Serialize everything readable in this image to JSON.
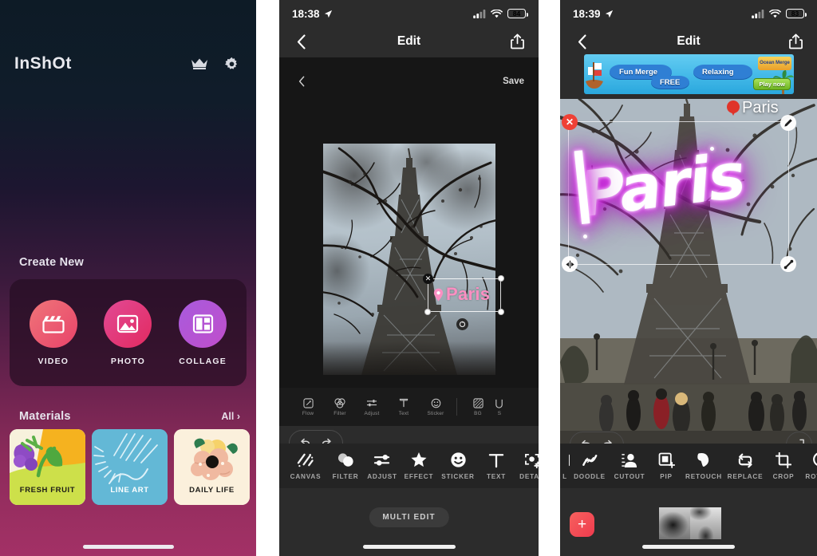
{
  "panel_home": {
    "brand": "InShOt",
    "icons": {
      "crown": "crown-icon",
      "settings": "gear-icon"
    },
    "create_new_title": "Create New",
    "create_items": [
      {
        "label": "VIDEO",
        "icon": "video-clapperboard-icon"
      },
      {
        "label": "PHOTO",
        "icon": "photo-image-icon"
      },
      {
        "label": "COLLAGE",
        "icon": "collage-grid-icon"
      }
    ],
    "materials_title": "Materials",
    "materials_all": "All ›",
    "materials": [
      {
        "label": "FRESH FRUIT",
        "theme": "fruit"
      },
      {
        "label": "LINE ART",
        "theme": "lineart"
      },
      {
        "label": "DAILY LIFE",
        "theme": "dailylife"
      }
    ]
  },
  "panel_edit": {
    "status": {
      "time": "18:38",
      "battery": "84",
      "location_icon": "location-arrow-icon",
      "signal_icon": "cellular-signal-icon",
      "wifi_icon": "wifi-icon"
    },
    "nav": {
      "back": "chevron-left-icon",
      "title": "Edit",
      "share": "share-upload-icon"
    },
    "inner": {
      "back": "chevron-left-icon",
      "save_label": "Save"
    },
    "sticker": {
      "text": "Paris",
      "pin_icon": "location-pin-icon",
      "color": "#fb8fc2"
    },
    "inner_tools": [
      {
        "label": "Flow",
        "icon": "flow-icon"
      },
      {
        "label": "Filter",
        "icon": "filter-circles-icon"
      },
      {
        "label": "Adjust",
        "icon": "adjust-sliders-icon"
      },
      {
        "label": "Text",
        "icon": "text-t-icon"
      },
      {
        "label": "Sticker",
        "icon": "sticker-smiley-icon"
      },
      {
        "label": "BG",
        "icon": "background-icon"
      },
      {
        "label": "S",
        "icon": "partial-icon"
      }
    ],
    "undo_redo": {
      "undo": "undo-arrow-icon",
      "redo": "redo-arrow-icon"
    },
    "expand": "expand-collapse-icon",
    "main_tools": [
      {
        "label": "CANVAS",
        "icon": "canvas-stripes-icon"
      },
      {
        "label": "FILTER",
        "icon": "filter-drops-icon"
      },
      {
        "label": "ADJUST",
        "icon": "adjust-sliders-icon"
      },
      {
        "label": "EFFECT",
        "icon": "effect-star-icon"
      },
      {
        "label": "STICKER",
        "icon": "sticker-smiley-icon"
      },
      {
        "label": "TEXT",
        "icon": "text-t-icon"
      },
      {
        "label": "DETAIL",
        "icon": "detail-focus-icon"
      },
      {
        "label": "D",
        "icon": "doodle-icon-partial"
      }
    ],
    "multi_edit_label": "MULTI EDIT"
  },
  "panel_doodle": {
    "status": {
      "time": "18:39",
      "battery": "83",
      "location_icon": "location-arrow-icon",
      "signal_icon": "cellular-signal-icon",
      "wifi_icon": "wifi-icon"
    },
    "nav": {
      "back": "chevron-left-icon",
      "title": "Edit",
      "share": "share-upload-icon"
    },
    "ad": {
      "text1": "Fun Merge",
      "text2": "FREE",
      "text3": "Relaxing",
      "cta": "Play now",
      "logo": "Ocean Merge"
    },
    "neon_doodle": {
      "text": "Paris",
      "color": "#ffffff",
      "glow": "#d923e8"
    },
    "photo_label": "Paris",
    "handles": {
      "close": "close-circle-icon",
      "edit": "pencil-edit-icon",
      "flip": "flip-horizontal-icon",
      "resize": "resize-diagonal-icon"
    },
    "undo_redo": {
      "undo": "undo-arrow-icon",
      "redo": "redo-arrow-icon"
    },
    "expand": "expand-collapse-icon",
    "main_tools": [
      {
        "label": "L",
        "icon": "partial-left-icon"
      },
      {
        "label": "DOODLE",
        "icon": "doodle-scribble-icon"
      },
      {
        "label": "CUTOUT",
        "icon": "cutout-person-icon"
      },
      {
        "label": "PIP",
        "icon": "pip-square-plus-icon"
      },
      {
        "label": "RETOUCH",
        "icon": "retouch-blob-icon"
      },
      {
        "label": "REPLACE",
        "icon": "replace-arrows-icon"
      },
      {
        "label": "CROP",
        "icon": "crop-icon"
      },
      {
        "label": "ROTATE",
        "icon": "rotate-icon"
      }
    ],
    "add_button": "+",
    "timeline_thumbs": 2
  }
}
